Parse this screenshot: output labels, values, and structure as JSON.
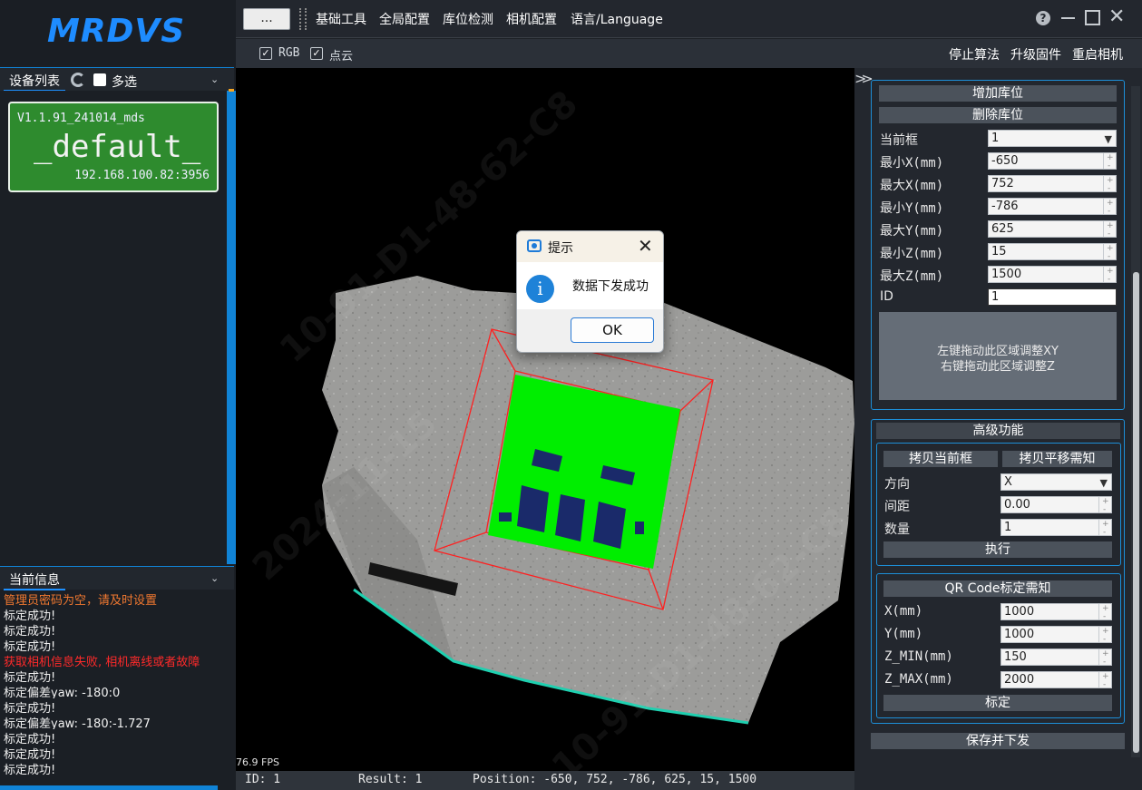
{
  "app": {
    "logo_text": "MRDVS",
    "watermark": "10-91-D1-48-62-C8",
    "watermark_date": "2024-11-15"
  },
  "device_panel": {
    "title": "设备列表",
    "multi_select_label": "多选",
    "device": {
      "version": "V1.1.91_241014_mds",
      "name": "_default_",
      "address": "192.168.100.82:3956",
      "card_color": "#2e8b2e"
    }
  },
  "info_panel": {
    "title": "当前信息",
    "log": [
      {
        "text": "管理员密码为空，请及时设置",
        "color": "#f07830"
      },
      {
        "text": "标定成功!",
        "color": "#f0f0f0"
      },
      {
        "text": "标定成功!",
        "color": "#f0f0f0"
      },
      {
        "text": "标定成功!",
        "color": "#f0f0f0"
      },
      {
        "text": "获取相机信息失败, 相机离线或者故障",
        "color": "#ff2a2a"
      },
      {
        "text": "标定成功!",
        "color": "#f0f0f0"
      },
      {
        "text": "标定偏差yaw: -180:0",
        "color": "#f0f0f0"
      },
      {
        "text": "标定成功!",
        "color": "#f0f0f0"
      },
      {
        "text": "标定偏差yaw: -180:-1.727",
        "color": "#f0f0f0"
      },
      {
        "text": "标定成功!",
        "color": "#f0f0f0"
      },
      {
        "text": "标定成功!",
        "color": "#f0f0f0"
      },
      {
        "text": "标定成功!",
        "color": "#f0f0f0"
      }
    ]
  },
  "topbar": {
    "more_button": "...",
    "menus": [
      "基础工具",
      "全局配置",
      "库位检测",
      "相机配置",
      "语言/Language"
    ],
    "help_icon": "?"
  },
  "toolbar": {
    "rgb_label": "RGB",
    "pointcloud_label": "点云",
    "rgb_checked": true,
    "pointcloud_checked": true,
    "stop_algo": "停止算法",
    "upgrade_fw": "升级固件",
    "restart_camera": "重启相机"
  },
  "viewport": {
    "fps": "76.9 FPS",
    "roi_color": "#ff2020",
    "detect_color": "#00ee00"
  },
  "statusbar": {
    "id": "ID: 1",
    "result": "Result: 1",
    "position": "Position: -650, 752, -786, 625, 15, 1500"
  },
  "dialog": {
    "title": "提示",
    "message": "数据下发成功",
    "ok": "OK",
    "info_glyph": "i"
  },
  "location_panel": {
    "add_button": "增加库位",
    "delete_button": "删除库位",
    "current_box_label": "当前框",
    "current_box_value": "1",
    "fields": [
      {
        "label": "最小X(mm)",
        "value": "-650"
      },
      {
        "label": "最大X(mm)",
        "value": "752"
      },
      {
        "label": "最小Y(mm)",
        "value": "-786"
      },
      {
        "label": "最大Y(mm)",
        "value": "625"
      },
      {
        "label": "最小Z(mm)",
        "value": "15"
      },
      {
        "label": "最大Z(mm)",
        "value": "1500"
      }
    ],
    "id_label": "ID",
    "id_value": "1",
    "drag_hint_xy": "左键拖动此区域调整XY",
    "drag_hint_z": "右键拖动此区域调整Z"
  },
  "advanced_panel": {
    "title": "高级功能",
    "copy_box_button": "拷贝当前框",
    "copy_shift_button": "拷贝平移需知",
    "direction_label": "方向",
    "direction_value": "X",
    "spacing_label": "间距",
    "spacing_value": "0.00",
    "count_label": "数量",
    "count_value": "1",
    "execute_button": "执行"
  },
  "qr_panel": {
    "title_button": "QR Code标定需知",
    "fields": [
      {
        "label": "X(mm)",
        "value": "1000"
      },
      {
        "label": "Y(mm)",
        "value": "1000"
      },
      {
        "label": "Z_MIN(mm)",
        "value": "150"
      },
      {
        "label": "Z_MAX(mm)",
        "value": "2000"
      }
    ],
    "calibrate_button": "标定"
  },
  "save_button": "保存并下发"
}
